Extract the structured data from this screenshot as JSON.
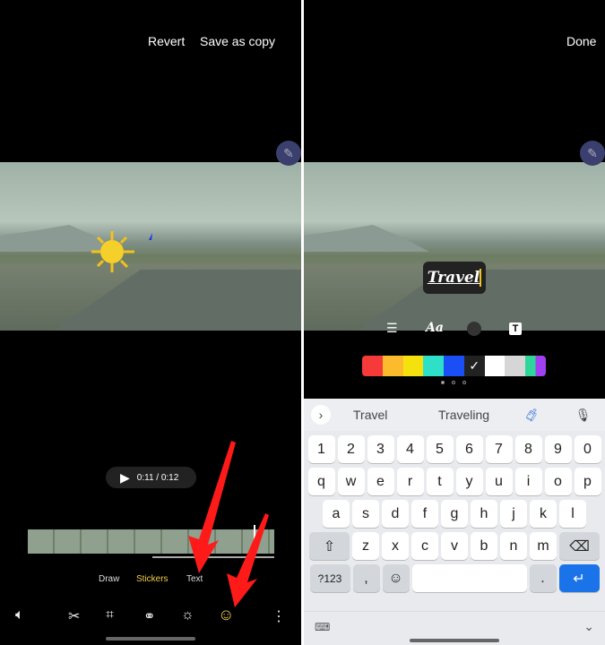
{
  "left": {
    "revert_label": "Revert",
    "save_copy_label": "Save as copy",
    "playback_time": "0:11 / 0:12",
    "modes": [
      "Draw",
      "Stickers",
      "Text"
    ],
    "active_mode": "Stickers",
    "tools": [
      "volume-icon",
      "cut-icon",
      "crop-rotate-icon",
      "filter-icon",
      "brightness-icon",
      "sticker-icon",
      "more-icon"
    ],
    "accent": "#f1cc4d"
  },
  "right": {
    "done_label": "Done",
    "text_input": "Travel",
    "font_label": "Aa",
    "palette": [
      "#f63a3a",
      "#fbbb2c",
      "#f5e10e",
      "#2fe0c9",
      "#1a4ff5",
      "#222222",
      "#ffffff",
      "#d6d6d6",
      "#multi"
    ],
    "selected_color": "#222222",
    "keyboard": {
      "suggestions": [
        "Travel",
        "Traveling"
      ],
      "row_numbers": [
        "1",
        "2",
        "3",
        "4",
        "5",
        "6",
        "7",
        "8",
        "9",
        "0"
      ],
      "row1": [
        "q",
        "w",
        "e",
        "r",
        "t",
        "y",
        "u",
        "i",
        "o",
        "p"
      ],
      "row2": [
        "a",
        "s",
        "d",
        "f",
        "g",
        "h",
        "j",
        "k",
        "l"
      ],
      "row3": [
        "z",
        "x",
        "c",
        "v",
        "b",
        "n",
        "m"
      ],
      "symbols_label": "?123",
      "comma": ",",
      "period": "."
    }
  },
  "annotation_color": "#ff1a1a"
}
